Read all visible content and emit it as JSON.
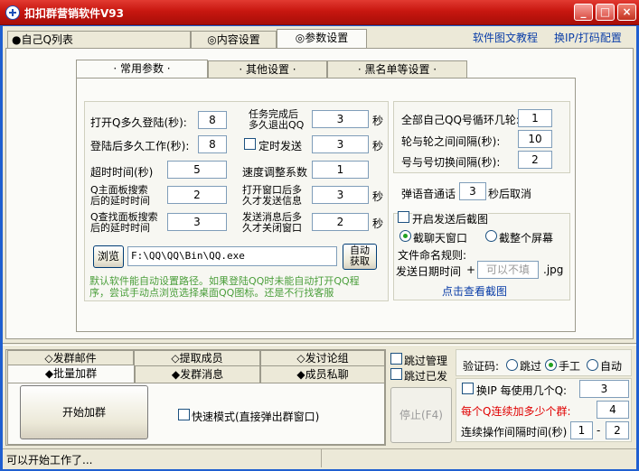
{
  "window": {
    "title": "扣扣群营销软件V93",
    "min": "_",
    "max": "□",
    "close": "×"
  },
  "main_tabs": [
    "●自己Q列表",
    "◎内容设置",
    "◎参数设置"
  ],
  "top_links": {
    "tutorial": "软件图文教程",
    "change_ip": "换IP/打码配置"
  },
  "sub_tabs": [
    "· 常用参数 ·",
    "· 其他设置 ·",
    "· 黑名单等设置 ·"
  ],
  "params": {
    "open_login_label": "打开Q多久登陆(秒):",
    "open_login_value": "8",
    "work_label": "登陆后多久工作(秒):",
    "work_value": "8",
    "timeout_label": "超时时间(秒)",
    "timeout_value": "5",
    "main_search_label_1": "Q主面板搜索",
    "main_search_label_2": "后的延时时间",
    "main_search_value": "2",
    "find_search_label_1": "Q查找面板搜索",
    "find_search_label_2": "后的延时时间",
    "find_search_value": "3",
    "task_done_label_1": "任务完成后",
    "task_done_label_2": "多久退出QQ",
    "task_done_value": "3",
    "task_done_unit": "秒",
    "timed_send_label": "定时发送",
    "timed_send_value": "3",
    "timed_send_unit": "秒",
    "speed_label": "速度调整系数",
    "speed_value": "1",
    "open_window_label_1": "打开窗口后多",
    "open_window_label_2": "久才发送信息",
    "open_window_value": "3",
    "open_window_unit": "秒",
    "after_send_label_1": "发送消息后多",
    "after_send_label_2": "久才关闭窗口",
    "after_send_value": "2",
    "after_send_unit": "秒"
  },
  "path": {
    "browse": "浏览",
    "value": "F:\\QQ\\QQ\\Bin\\QQ.exe",
    "auto_1": "自动",
    "auto_2": "获取"
  },
  "hint": {
    "line1": "默认软件能自动设置路径。如果登陆QQ时未能自动打开QQ程",
    "line2": "序，尝试手动点浏览选择桌面QQ图标。还是不行找客服"
  },
  "loop": {
    "rounds_label": "全部自己QQ号循环几轮:",
    "rounds_value": "1",
    "round_interval_label": "轮与轮之间间隔(秒):",
    "round_interval_value": "10",
    "switch_label": "号与号切换间隔(秒):",
    "switch_value": "2"
  },
  "voice": {
    "label": "弹语音通话",
    "value": "3",
    "suffix": "秒后取消"
  },
  "screenshot": {
    "enable_label": "开启发送后截图",
    "radio_chat": "截聊天窗口",
    "radio_full": "截整个屏幕",
    "naming_label": "文件命名规则:",
    "date_label": "发送日期时间",
    "plus": "+",
    "placeholder": "可以不填",
    "ext": ".jpg",
    "view_link": "点击查看截图"
  },
  "bottom_tabs_row1": [
    "◇发群邮件",
    "◇提取成员",
    "◇发讨论组"
  ],
  "bottom_tabs_row2": [
    "◆批量加群",
    "◆发群消息",
    "◆成员私聊"
  ],
  "actions": {
    "start": "开始加群",
    "fast_mode": "快速模式(直接弹出群窗口)",
    "stop": "停止(F4)"
  },
  "skip": {
    "admin": "跳过管理",
    "sent": "跳过已发"
  },
  "captcha": {
    "label": "验证码:",
    "skip": "跳过",
    "manual": "手工",
    "auto": "自动"
  },
  "ip": {
    "label": "换IP 每使用几个Q:",
    "value": "3"
  },
  "per_q": {
    "label": "每个Q连续加多少个群:",
    "value": "4"
  },
  "continuous": {
    "label": "连续操作间隔时间(秒)",
    "from": "1",
    "dash": "-",
    "to": "2"
  },
  "status": "可以开始工作了..."
}
